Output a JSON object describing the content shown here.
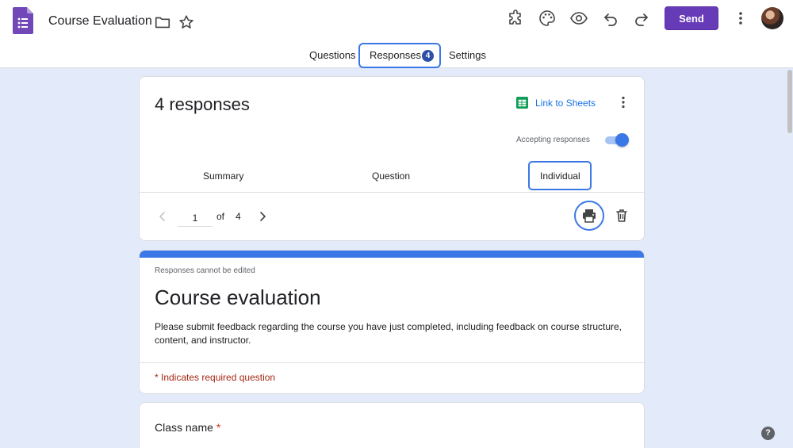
{
  "header": {
    "doc_title": "Course Evaluation",
    "send_label": "Send",
    "icons": [
      "forms-logo-icon",
      "folder-icon",
      "star-icon",
      "addons-icon",
      "palette-icon",
      "preview-eye-icon",
      "undo-icon",
      "redo-icon",
      "more-vert-icon",
      "avatar"
    ]
  },
  "tabs": [
    {
      "label": "Questions",
      "active": false
    },
    {
      "label": "Responses",
      "active": true,
      "badge": "4"
    },
    {
      "label": "Settings",
      "active": false
    }
  ],
  "summary_card": {
    "responses_count": "4 responses",
    "link_sheets": "Link to Sheets",
    "accepting_label": "Accepting responses",
    "accepting_on": true,
    "subtabs": [
      {
        "label": "Summary",
        "active": false
      },
      {
        "label": "Question",
        "active": false
      },
      {
        "label": "Individual",
        "active": true
      }
    ],
    "pager": {
      "current": "1",
      "of_label": "of",
      "total": "4"
    }
  },
  "form_card": {
    "cannot_edit": "Responses cannot be edited",
    "title": "Course evaluation",
    "description": "Please submit feedback regarding the course you have just completed, including feedback on course structure, content, and instructor.",
    "required_note": "* Indicates required question"
  },
  "question_card": {
    "title": "Class name",
    "required_marker": "*"
  },
  "help_label": "?",
  "colors": {
    "accent": "#673ab7",
    "blue": "#3b78e7",
    "background": "#e3ebfb",
    "required": "#a52714",
    "sheets_green": "#0f9d58"
  }
}
